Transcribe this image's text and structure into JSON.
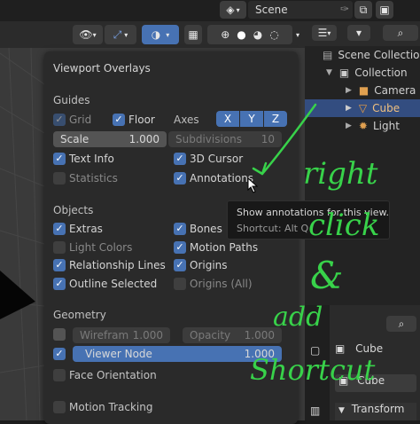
{
  "topbar": {
    "scene_label": "Scene"
  },
  "overlays": {
    "title": "Viewport Overlays",
    "guides": {
      "heading": "Guides",
      "grid": "Grid",
      "floor": "Floor",
      "axes": "Axes",
      "axis_x": "X",
      "axis_y": "Y",
      "axis_z": "Z",
      "scale_label": "Scale",
      "scale_value": "1.000",
      "subdivisions_label": "Subdivisions",
      "subdivisions_value": "10",
      "text_info": "Text Info",
      "cursor_3d": "3D Cursor",
      "statistics": "Statistics",
      "annotations": "Annotations"
    },
    "objects": {
      "heading": "Objects",
      "extras": "Extras",
      "bones": "Bones",
      "light_colors": "Light Colors",
      "motion_paths": "Motion Paths",
      "relationship_lines": "Relationship Lines",
      "origins": "Origins",
      "outline_selected": "Outline Selected",
      "origins_all": "Origins (All)"
    },
    "geometry": {
      "heading": "Geometry",
      "wireframe_label": "Wirefram",
      "wireframe_value": "1.000",
      "opacity_label": "Opacity",
      "opacity_value": "1.000",
      "viewer_node_label": "Viewer Node",
      "viewer_node_value": "1.000",
      "face_orientation": "Face Orientation",
      "motion_tracking": "Motion Tracking"
    }
  },
  "tooltip": {
    "text": "Show annotations for this view.",
    "shortcut": "Shortcut: Alt Q"
  },
  "outliner": {
    "items": [
      {
        "label": "Scene Collection"
      },
      {
        "label": "Collection"
      },
      {
        "label": "Camera"
      },
      {
        "label": "Cube"
      },
      {
        "label": "Light"
      }
    ]
  },
  "properties": {
    "object_name": "Cube",
    "mesh_name": "Cube",
    "transform": "Transform"
  },
  "annotation_handwriting": {
    "line1": "right",
    "line2": "click",
    "line3": "&",
    "line4": "add",
    "line5": "Shortcut"
  },
  "colors": {
    "accent": "#4772b3",
    "handwriting": "#38d24a",
    "panel": "#2a2a2a"
  }
}
